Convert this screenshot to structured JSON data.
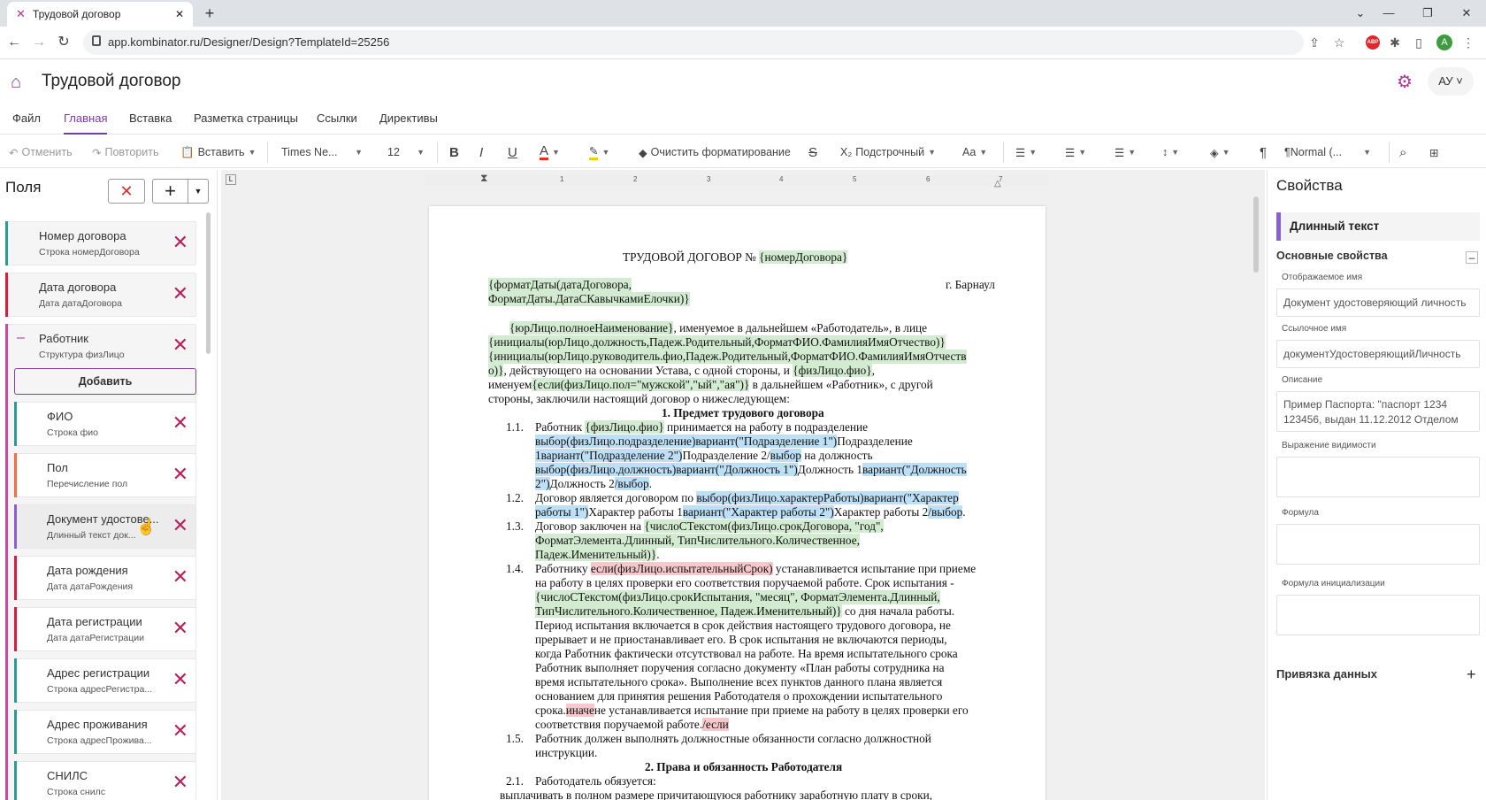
{
  "browser": {
    "tab_title": "Трудовой договор",
    "url": "app.kombinator.ru/Designer/Design?TemplateId=25256",
    "profile_initial": "A",
    "ext_label": "ABP"
  },
  "app": {
    "title": "Трудовой договор",
    "user": "АУ ˅"
  },
  "menu": [
    "Файл",
    "Главная",
    "Вставка",
    "Разметка страницы",
    "Ссылки",
    "Директивы"
  ],
  "toolbar": {
    "undo": "Отменить",
    "redo": "Повторить",
    "paste": "Вставить",
    "font": "Times Ne...",
    "size": "12",
    "clear_format": "Очистить форматирование",
    "subscript": "Подстрочный",
    "case": "Aa",
    "style": "¶Normal (..."
  },
  "fields": {
    "title": "Поля",
    "add_label": "Добавить",
    "items": [
      {
        "name": "Номер договора",
        "sub": "Строка номерДоговора",
        "color": "#2a9d8f"
      },
      {
        "name": "Дата договора",
        "sub": "Дата датаДоговора",
        "color": "#d3203f"
      },
      {
        "name": "Работник",
        "sub": "Структура физЛицо",
        "color": "#c44fa0"
      }
    ],
    "children": [
      {
        "name": "ФИО",
        "sub": "Строка фио",
        "color": "#2a9d8f"
      },
      {
        "name": "Пол",
        "sub": "Перечисление пол",
        "color": "#f07040"
      },
      {
        "name": "Документ удостове...",
        "sub": "Длинный текст док...",
        "color": "#8a5fd6"
      },
      {
        "name": "Дата рождения",
        "sub": "Дата датаРождения",
        "color": "#d3203f"
      },
      {
        "name": "Дата регистрации",
        "sub": "Дата датаРегистрации",
        "color": "#d3203f"
      },
      {
        "name": "Адрес регистрации",
        "sub": "Строка адресРегистра...",
        "color": "#2a9d8f"
      },
      {
        "name": "Адрес проживания",
        "sub": "Строка адресПрожива...",
        "color": "#2a9d8f"
      },
      {
        "name": "СНИЛС",
        "sub": "Строка снилс",
        "color": "#2a9d8f"
      }
    ]
  },
  "ruler": [
    "1",
    "2",
    "3",
    "4",
    "5",
    "6",
    "7"
  ],
  "document": {
    "l1": "ТРУДОВОЙ ДОГОВОР № ",
    "l1f": "{номерДоговора}",
    "l2a": "{форматДаты(датаДоговора,",
    "l2b": "г. Барнаул",
    "l3": "ФорматДаты.ДатаСКавычкамиЕлочки)}",
    "l4a": "{юрЛицо.полноеНаименование}",
    "l4b": ",   именуемое   в   дальнейшем   «Работодатель»,   в   лице",
    "l5": "{инициалы(юрЛицо.должность,Падеж.Родительный,ФорматФИО.ФамилияИмяОтчество)}",
    "l6": "{инициалы(юрЛицо.руководитель.фио,Падеж.Родительный,ФорматФИО.ФамилияИмяОтчеств",
    "l7a": "о)}",
    "l7b": ",    действующего    на    основании    Устава,    с    одной    стороны,    и    ",
    "l7c": "{физЛицо.фио}",
    "l7d": ",",
    "l8a": "именуем",
    "l8b": "{если(физЛицо.пол=\"мужской\",\"ый\",\"ая\")}",
    "l8c": "  в  дальнейшем  «Работник»,  с  другой",
    "l9": "стороны, заключили настоящий договор о нижеследующем:",
    "h1": "1.   Предмет трудового договора",
    "p11n": "1.1.",
    "p11a": "Работник       ",
    "p11b": "{физЛицо.фио}",
    "p11c": "       принимается       на       работу       в       подразделение",
    "p11l2a": "выбор(физЛицо.подразделение)вариант(\"Подразделение                    1\")",
    "p11l2b": "Подразделение",
    "p11l3a": "1вариант(\"Подразделение          2\")",
    "p11l3b": "Подразделение          2/",
    "p11l3c": "выбор",
    "p11l3d": "           на           должность",
    "p11l4a": "выбор(физЛицо.должность)вариант(\"Должность   1\")",
    "p11l4b": "Должность   1",
    "p11l4c": "вариант(\"Должность",
    "p11l5a": "2\")",
    "p11l5b": "Должность 2",
    "p11l5c": "/выбор",
    "p11l5d": ".",
    "p12n": "1.2.",
    "p12a": "Договор   является   договором   по   ",
    "p12b": "выбор(физЛицо.характерРаботы)вариант(\"Характер",
    "p12l2a": "работы 1\")",
    "p12l2b": "Характер работы 1",
    "p12l2c": "вариант(\"Характер работы 2\")",
    "p12l2d": "Характер работы 2",
    "p12l2e": "/выбор",
    "p12l2f": ".",
    "p13n": "1.3.",
    "p13a": "Договор        заключен        на        ",
    "p13b": "{числоСТекстом(физЛицо.срокДоговора,        \"год\",",
    "p13l2": "ФорматЭлемента.Длинный,                         ТипЧислительного.Количественное,",
    "p13l3a": "Падеж.Именительный)}",
    "p13l3b": ".",
    "p14n": "1.4.",
    "p14a": "Работнику ",
    "p14b": "если(физЛицо.испытательныйСрок)",
    "p14c": " устанавливается испытание при приеме",
    "p14l2": "на работу в целях проверки его соответствия поручаемой работе. Срок испытания -",
    "p14l3": "{числоСТекстом(физЛицо.срокИспытания,       \"месяц\",       ФорматЭлемента.Длинный,",
    "p14l4a": "ТипЧислительного.Количественное,   Падеж.Именительный)}",
    "p14l4b": "   со   дня   начала   работы.",
    "p14l5": "Период  испытания  включается  в  срок  действия  настоящего  трудового  договора,  не",
    "p14l6": "прерывает  и  не  приостанавливает  его.  В  срок  испытания  не  включаются  периоды,",
    "p14l7": "когда  Работник  фактически  отсутствовал  на  работе.  На  время  испытательного  срока",
    "p14l8": "Работник  выполняет  поручения  согласно  документу  «План  работы  сотрудника  на",
    "p14l9": "время   испытательного   срока».   Выполнение   всех   пунктов   данного   плана   является",
    "p14l10": "основанием   для   принятия   решения   Работодателя   о   прохождении   испытательного",
    "p14l11a": "срока.",
    "p14l11b": "иначе",
    "p14l11c": "не устанавливается испытание при приеме на работу в целях проверки его",
    "p14l12a": "соответствия поручаемой работе.",
    "p14l12b": "/если",
    "p15n": "1.5.",
    "p15a": "Работник   должен   выполнять   должностные   обязанности   согласно   должностной",
    "p15l2": "инструкции.",
    "h2": "2.   Права и обязанность Работодателя",
    "p21n": "2.1.",
    "p21a": "Работодатель обязуется:",
    "p21l2": "выплачивать  в  полном  размере  причитающуюся  работнику  заработную  плату  в  сроки,"
  },
  "properties": {
    "title": "Свойства",
    "type": "Длинный текст",
    "main": "Основные свойства",
    "display_label": "Отображаемое имя",
    "display_value": "Документ удостоверяющий личность",
    "ref_label": "Ссылочное имя",
    "ref_value": "документУдостоверяющийЛичность",
    "desc_label": "Описание",
    "desc_value": "Пример Паспорта: \"паспорт 1234 123456, выдан 11.12.2012 Отделом",
    "vis_label": "Выражение видимости",
    "formula_label": "Формула",
    "init_label": "Формула инициализации",
    "binding": "Привязка данных"
  }
}
